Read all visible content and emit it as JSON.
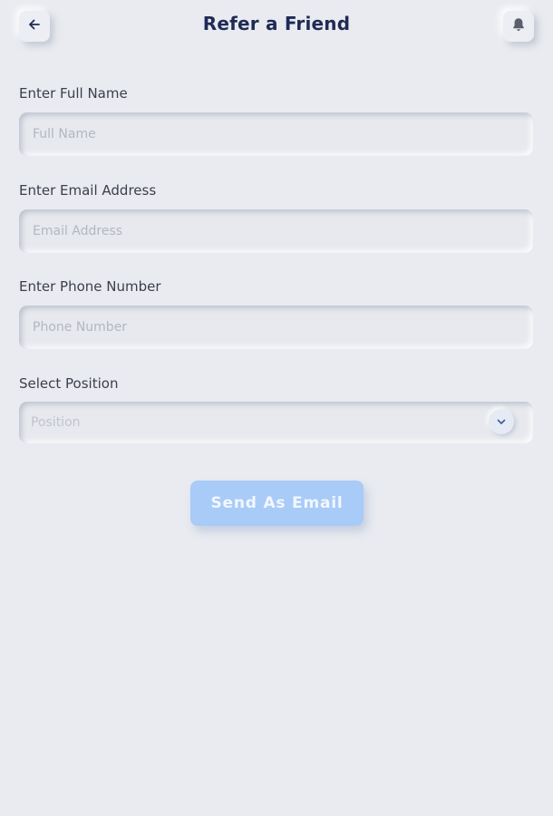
{
  "header": {
    "title": "Refer a Friend",
    "back_icon": "arrow-left-icon",
    "notification_icon": "bell-icon"
  },
  "form": {
    "full_name": {
      "label": "Enter Full Name",
      "placeholder": "Full Name",
      "value": ""
    },
    "email": {
      "label": "Enter Email Address",
      "placeholder": "Email Address",
      "value": ""
    },
    "phone": {
      "label": "Enter Phone Number",
      "placeholder": "Phone Number",
      "value": ""
    },
    "position": {
      "label": "Select Position",
      "placeholder": "Position",
      "icon": "chevron-down-icon"
    }
  },
  "actions": {
    "send_label": "Send As Email"
  },
  "colors": {
    "background": "#E9EBF0",
    "title": "#1F2A55",
    "accent_button": "#A9CBF7",
    "chevron": "#3E5C9A"
  }
}
